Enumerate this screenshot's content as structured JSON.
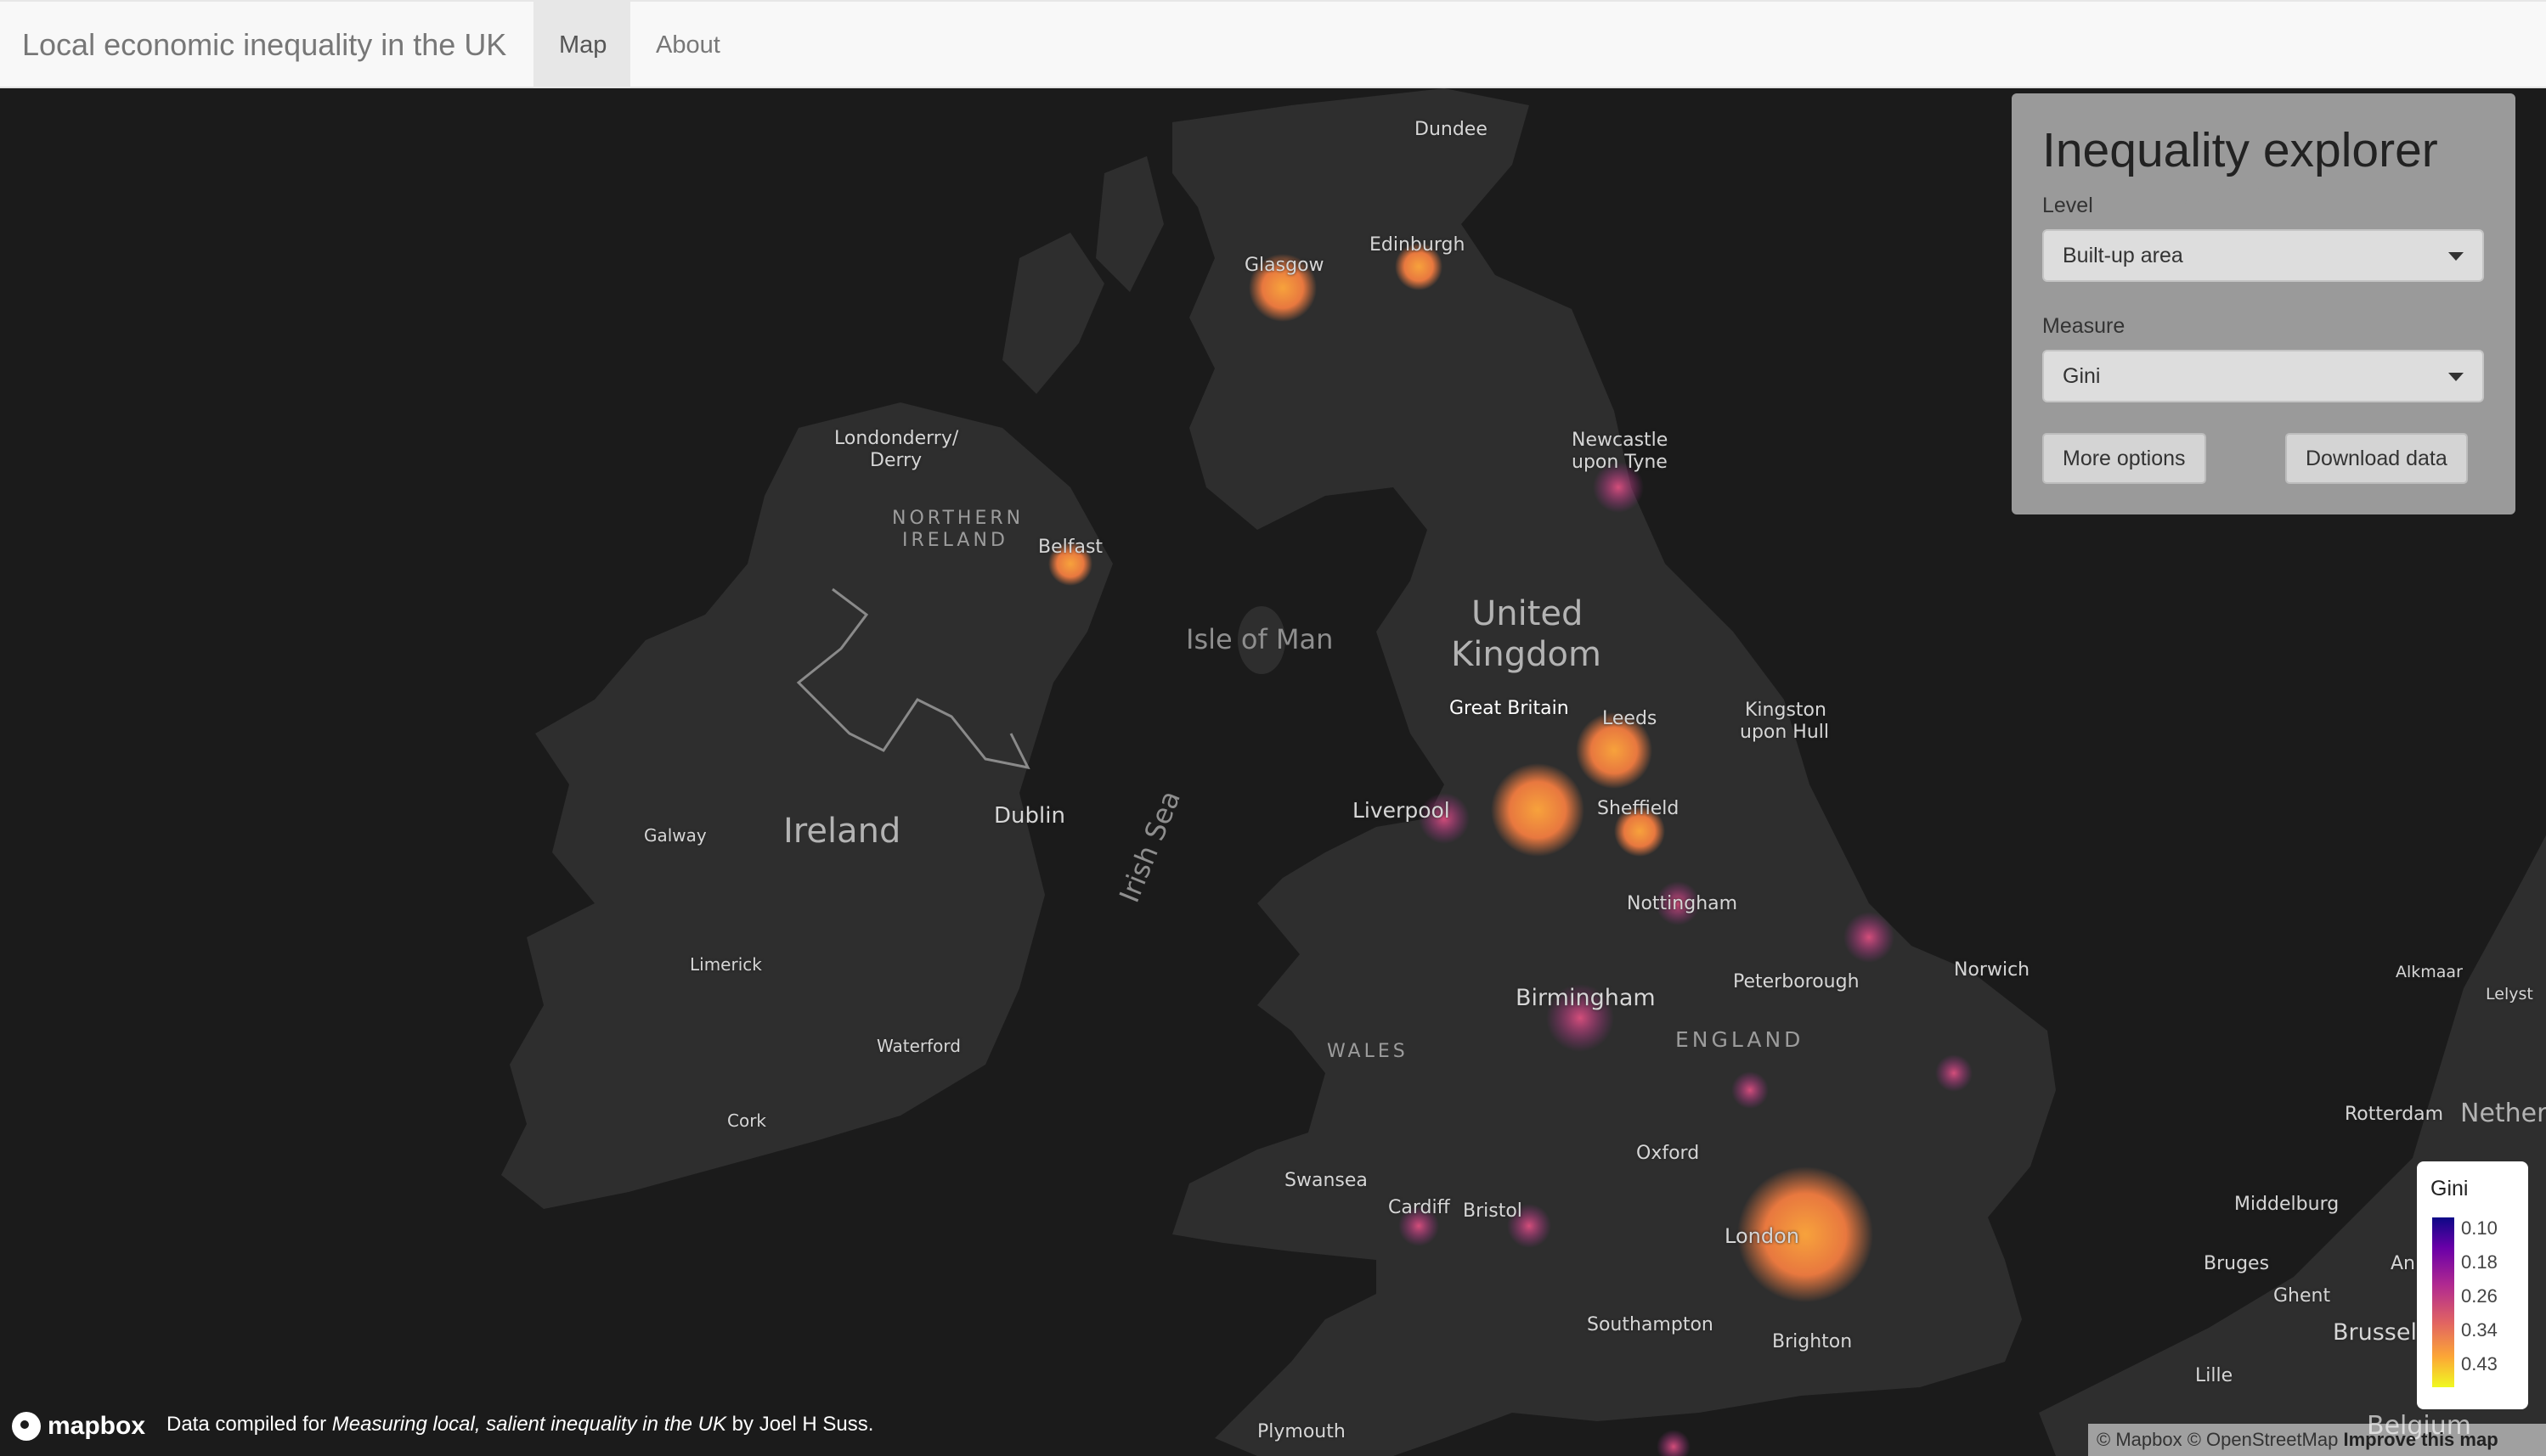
{
  "navbar": {
    "brand": "Local economic inequality in the UK",
    "tabs": [
      {
        "label": "Map",
        "active": true
      },
      {
        "label": "About",
        "active": false
      }
    ]
  },
  "panel": {
    "title": "Inequality explorer",
    "level_label": "Level",
    "level_value": "Built-up area",
    "measure_label": "Measure",
    "measure_value": "Gini",
    "more_options_label": "More options",
    "download_label": "Download data"
  },
  "legend": {
    "title": "Gini",
    "ticks": [
      "0.10",
      "0.18",
      "0.26",
      "0.34",
      "0.43"
    ]
  },
  "map_labels": {
    "dundee": "Dundee",
    "glasgow": "Glasgow",
    "edinburgh": "Edinburgh",
    "londonderry": "Londonderry/",
    "derry": "Derry",
    "northern_ireland_1": "NORTHERN",
    "northern_ireland_2": "IRELAND",
    "belfast": "Belfast",
    "newcastle_1": "Newcastle",
    "newcastle_2": "upon Tyne",
    "isle_of_man": "Isle of Man",
    "united_kingdom_1": "United",
    "united_kingdom_2": "Kingdom",
    "great_britain": "Great Britain",
    "leeds": "Leeds",
    "kingston_1": "Kingston",
    "kingston_2": "upon Hull",
    "galway": "Galway",
    "ireland": "Ireland",
    "dublin": "Dublin",
    "irish_sea": "Irish Sea",
    "liverpool": "Liverpool",
    "sheffield": "Sheffield",
    "nottingham": "Nottingham",
    "limerick": "Limerick",
    "waterford": "Waterford",
    "cork": "Cork",
    "birmingham": "Birmingham",
    "peterborough": "Peterborough",
    "norwich": "Norwich",
    "wales": "WALES",
    "england": "ENGLAND",
    "oxford": "Oxford",
    "swansea": "Swansea",
    "cardiff": "Cardiff",
    "bristol": "Bristol",
    "london": "London",
    "southampton": "Southampton",
    "brighton": "Brighton",
    "plymouth": "Plymouth",
    "alkmaar": "Alkmaar",
    "lelystad": "Lelyst",
    "rotterdam": "Rotterdam",
    "netherlands": "Nether",
    "middelburg": "Middelburg",
    "bruges": "Bruges",
    "ghent": "Ghent",
    "antwerp": "An",
    "brussels": "Brussel",
    "lille": "Lille",
    "belgium": "Belgium",
    "north_sea_fragment": "Sea"
  },
  "footer": {
    "mapbox": "mapbox",
    "source_prefix": "Data compiled for ",
    "source_title": "Measuring local, salient inequality in the UK",
    "source_suffix": " by Joel H Suss.",
    "attrib_mapbox": "© Mapbox",
    "attrib_osm": "© OpenStreetMap",
    "attrib_improve": "Improve this map"
  },
  "colors": {
    "map_background": "#1b1b1b",
    "land": "#2e2e2e",
    "legend_low": "#0d0887",
    "legend_high": "#f0f921"
  }
}
